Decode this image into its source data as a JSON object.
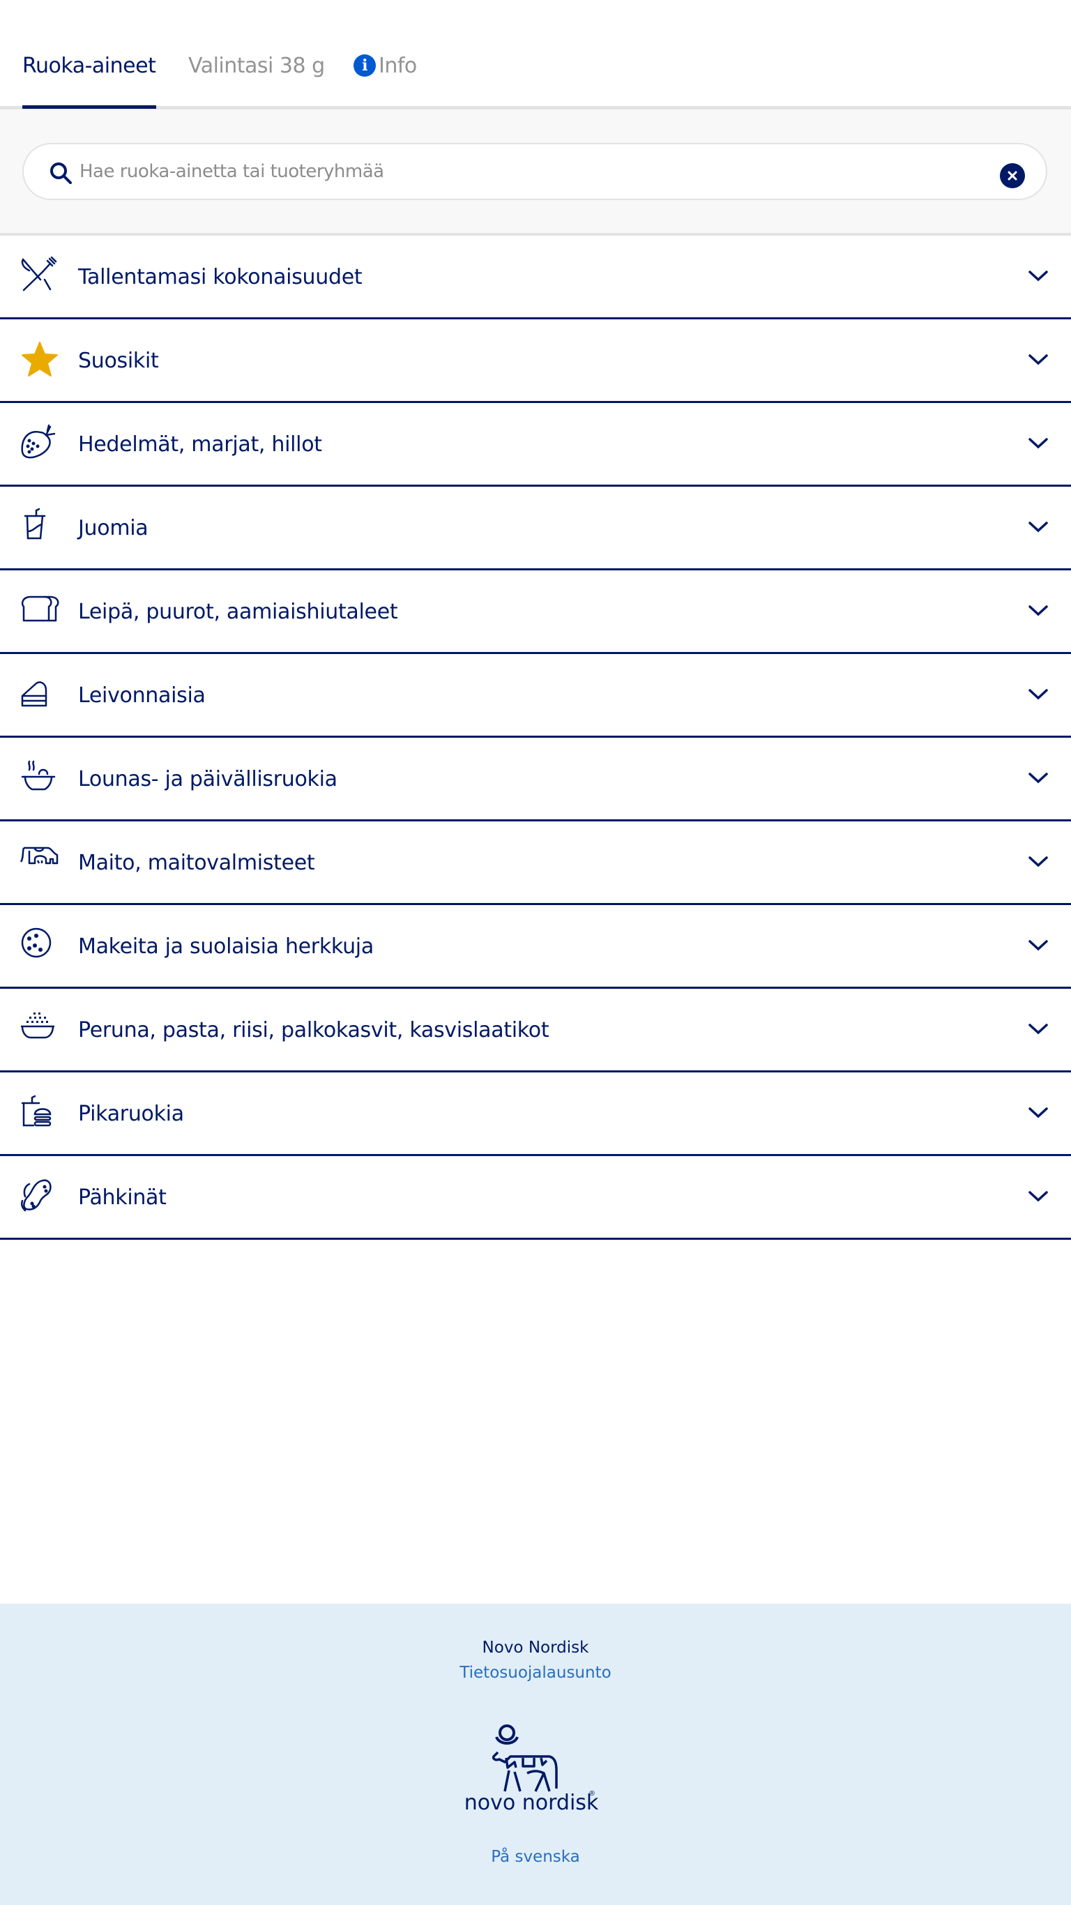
{
  "tabs": [
    {
      "label": "Ruoka-aineet",
      "active": true
    },
    {
      "label": "Valintasi 38 g",
      "active": false
    },
    {
      "label": "Info",
      "active": false,
      "icon": "info-icon"
    }
  ],
  "search": {
    "placeholder": "Hae ruoka-ainetta tai tuoteryhmää",
    "value": "",
    "icon": "search-icon",
    "clear_icon": "close-circle-icon"
  },
  "categories": [
    {
      "label": "Tallentamasi kokonaisuudet",
      "icon": "fork-knife-icon"
    },
    {
      "label": "Suosikit",
      "icon": "star-icon"
    },
    {
      "label": "Hedelmät, marjat, hillot",
      "icon": "strawberry-icon"
    },
    {
      "label": "Juomia",
      "icon": "drink-cup-icon"
    },
    {
      "label": "Leipä, puurot, aamiaishiutaleet",
      "icon": "bread-icon"
    },
    {
      "label": "Leivonnaisia",
      "icon": "cake-slice-icon"
    },
    {
      "label": "Lounas- ja päivällisruokia",
      "icon": "soup-bowl-icon"
    },
    {
      "label": "Maito, maitovalmisteet",
      "icon": "cow-icon"
    },
    {
      "label": "Makeita ja suolaisia herkkuja",
      "icon": "cookie-icon"
    },
    {
      "label": "Peruna, pasta, riisi, palkokasvit, kasvislaatikot",
      "icon": "rice-bowl-icon"
    },
    {
      "label": "Pikaruokia",
      "icon": "fast-food-icon"
    },
    {
      "label": "Pähkinät",
      "icon": "peanut-icon"
    }
  ],
  "footer": {
    "company": "Novo Nordisk",
    "privacy_link": "Tietosuojalausunto",
    "logo_text": "novo nordisk",
    "logo_mark": "®",
    "language_link": "På svenska"
  },
  "colors": {
    "primary": "#001965",
    "accent_star": "#eaab00",
    "info_blue": "#005ad2",
    "link_blue": "#2a6ebb",
    "footer_bg": "#e1eef8"
  }
}
